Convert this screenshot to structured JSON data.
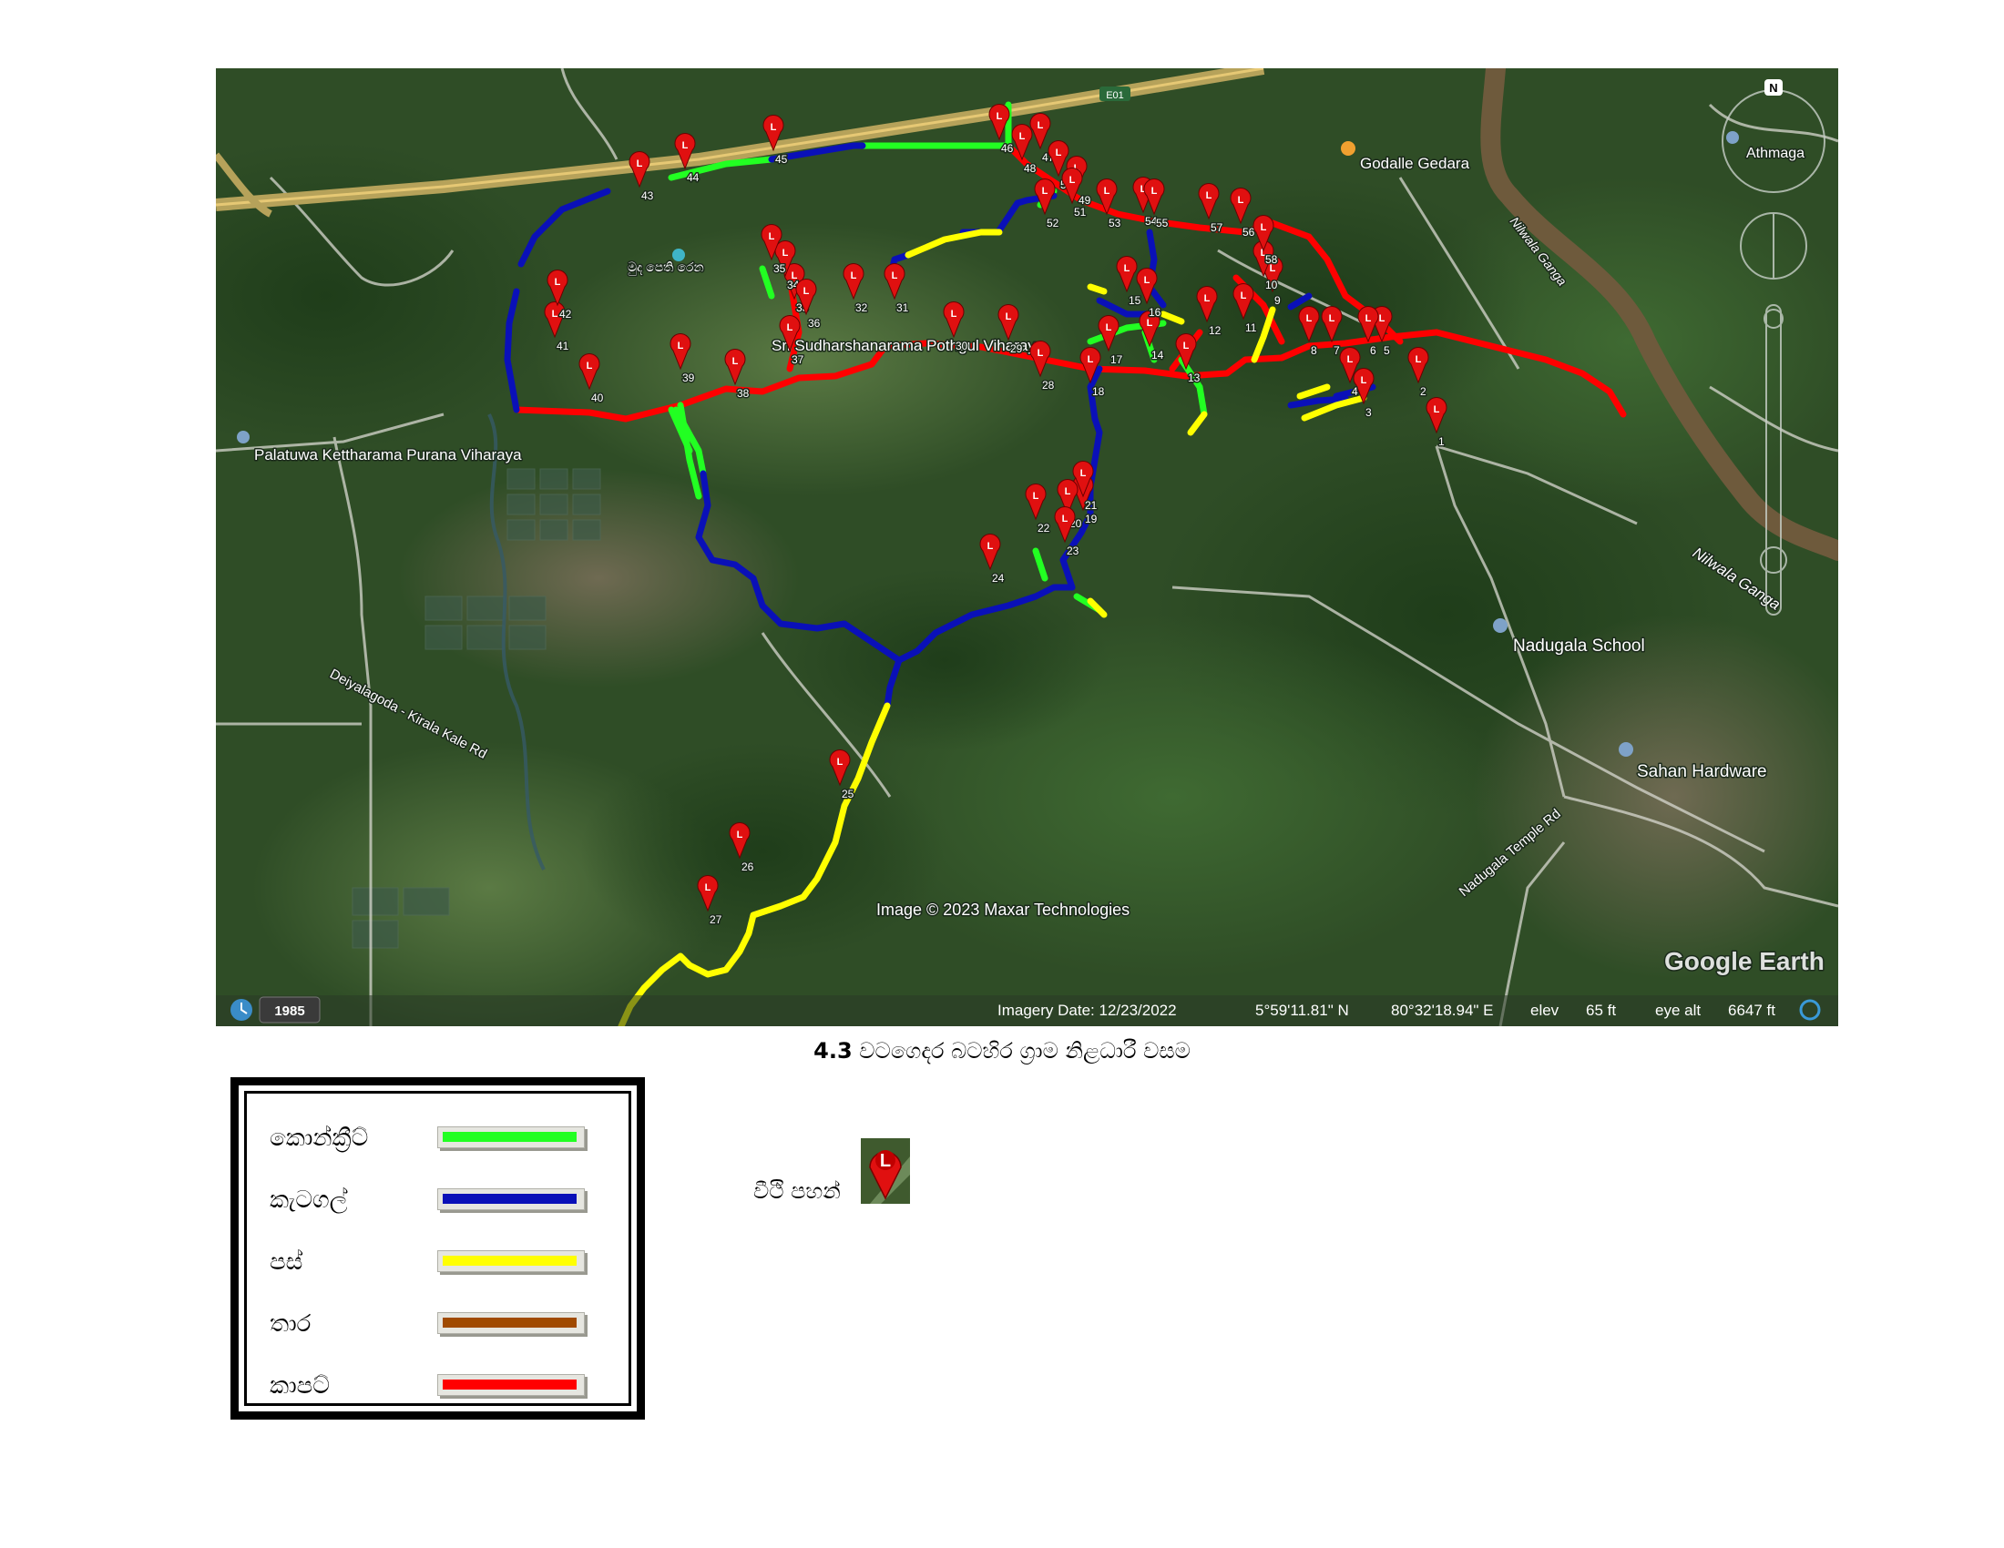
{
  "map": {
    "places": {
      "godalle_gedara": "Godalle Gedara",
      "athmaga": "Athmaga",
      "nilwala_ganga_upper": "Nilwala Ganga",
      "nilwala_ganga_lower": "Nilwala Ganga",
      "temple_main": "Sri Sudharshanarama Pothgul Viharaya",
      "temple_local": "මුද පෙති රෙන",
      "palatuwa": "Palatuwa Kettharama Purana Viharaya",
      "nadugala_school": "Nadugala School",
      "sahan_hardware": "Sahan Hardware",
      "road_deiyalagoda": "Deiyalagoda - Kirala Kale Rd",
      "road_nadugala": "Nadugala Temple Rd",
      "expressway_shield": "E01"
    },
    "compass_label": "N",
    "attribution": "Image © 2023 Maxar Technologies",
    "brand": "Google Earth",
    "history_year": "1985",
    "status_bar": {
      "imagery_date": "Imagery Date: 12/23/2022",
      "latitude": "5°59'11.81\" N",
      "longitude": "80°32'18.94\" E",
      "elev_label": "elev",
      "elev_value": "65 ft",
      "eye_alt_label": "eye alt",
      "eye_alt_value": "6647 ft"
    },
    "pin_letter": "L",
    "pins": [
      "1",
      "2",
      "3",
      "4",
      "5",
      "6",
      "7",
      "8",
      "9",
      "10",
      "11",
      "12",
      "13",
      "14",
      "15",
      "16",
      "17",
      "18",
      "19",
      "20",
      "21",
      "22",
      "23",
      "24",
      "25",
      "26",
      "27",
      "28",
      "29",
      "30",
      "31",
      "32",
      "33",
      "34",
      "35",
      "36",
      "37",
      "38",
      "39",
      "40",
      "41",
      "42",
      "43",
      "44",
      "45",
      "46",
      "47",
      "48",
      "49",
      "50",
      "51",
      "52",
      "53",
      "54",
      "55",
      "56",
      "57",
      "58"
    ]
  },
  "caption": {
    "number": "4.3",
    "text": " වටගෙදර බටහිර ග්‍රාම නිළධාරී වසම"
  },
  "legend": {
    "items": [
      {
        "label": "කොන්ක්‍රීට්",
        "color": "#22ff22"
      },
      {
        "label": "කැටගල්",
        "color": "#0a10b8"
      },
      {
        "label": "පස්",
        "color": "#ffff00"
      },
      {
        "label": "තාර",
        "color": "#a04a00"
      },
      {
        "label": "කාපට්",
        "color": "#ff0000"
      }
    ]
  },
  "lamp_note": {
    "label": "වීථි පහන්",
    "icon": "street-lamp-pin-icon"
  },
  "colors": {
    "concrete": "#22ff22",
    "cabook": "#0a10b8",
    "gravel": "#ffff00",
    "tar": "#a04a00",
    "carpet": "#ff0000",
    "pin": "#e01010"
  }
}
